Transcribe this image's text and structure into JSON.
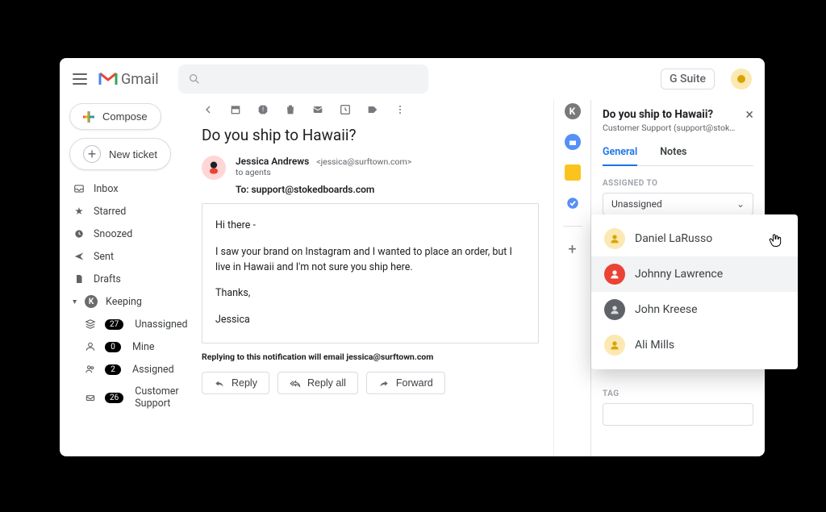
{
  "header": {
    "product": "Gmail",
    "suite_label": "G Suite"
  },
  "sidebar": {
    "compose": "Compose",
    "new_ticket": "New ticket",
    "items": [
      {
        "icon": "inbox",
        "label": "Inbox"
      },
      {
        "icon": "star",
        "label": "Starred"
      },
      {
        "icon": "clock",
        "label": "Snoozed"
      },
      {
        "icon": "send",
        "label": "Sent"
      },
      {
        "icon": "file",
        "label": "Drafts"
      }
    ],
    "keeping_label": "Keeping",
    "keeping": [
      {
        "icon": "stack",
        "count": "27",
        "label": "Unassigned"
      },
      {
        "icon": "person",
        "count": "0",
        "label": "Mine"
      },
      {
        "icon": "people",
        "count": "2",
        "label": "Assigned"
      },
      {
        "icon": "mailbox",
        "count": "26",
        "label": "Customer Support"
      }
    ]
  },
  "thread": {
    "subject": "Do you ship to Hawaii?",
    "sender_name": "Jessica Andrews",
    "sender_email": "<jessica@surftown.com>",
    "to_agents": "to agents",
    "to_label": "To:",
    "to_value": "support@stokedboards.com",
    "body_greeting": "Hi there -",
    "body_main": "I saw your brand on Instagram and I wanted to place an order, but I live in Hawaii and I'm not sure you ship here.",
    "body_close1": "Thanks,",
    "body_close2": "Jessica",
    "reply_note": "Replying to this notification will email jessica@surftown.com",
    "actions": {
      "reply": "Reply",
      "reply_all": "Reply all",
      "forward": "Forward"
    }
  },
  "panel": {
    "title": "Do you ship to Hawaii?",
    "subtitle": "Customer Support (support@stok…",
    "tabs": {
      "general": "General",
      "notes": "Notes"
    },
    "assigned_label": "ASSIGNED TO",
    "assigned_value": "Unassigned",
    "options": [
      "Daniel LaRusso",
      "Johnny Lawrence",
      "John Kreese",
      "Ali Mills"
    ],
    "tag_label": "TAG"
  }
}
